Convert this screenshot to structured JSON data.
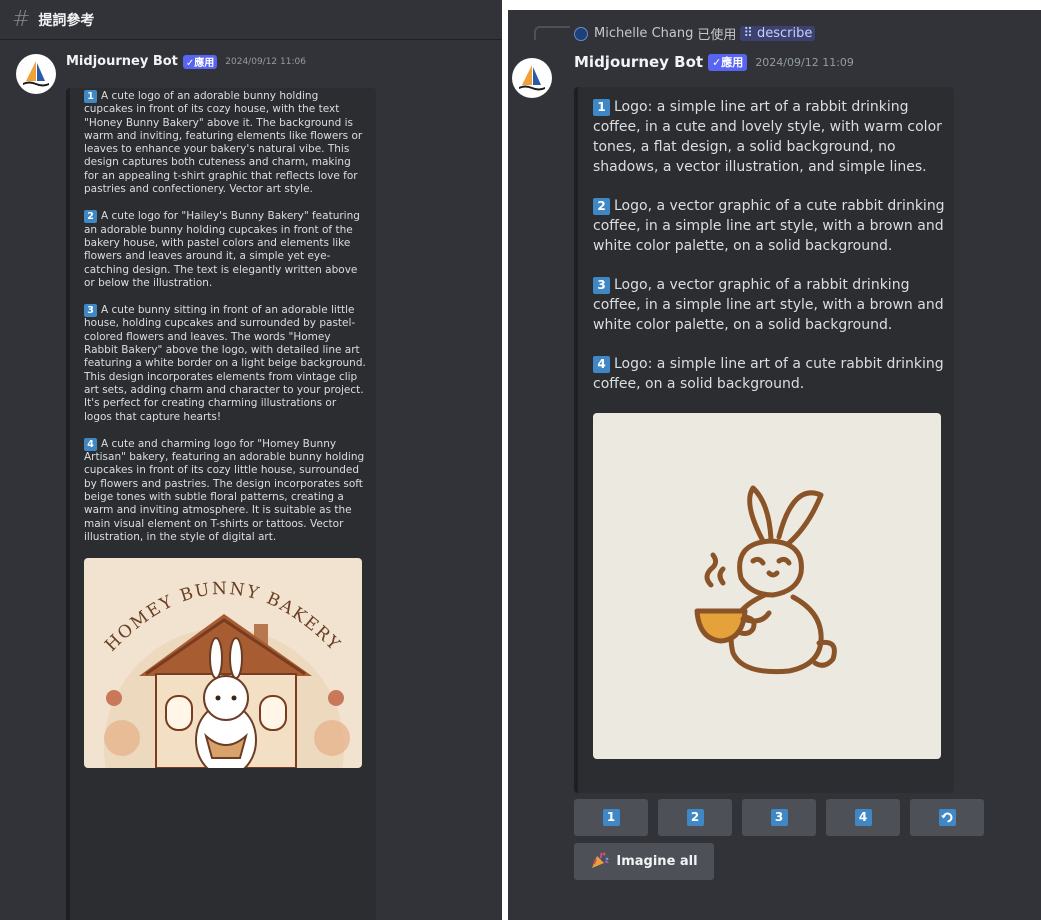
{
  "left_panel": {
    "channel": {
      "icon": "hash-icon",
      "name": "提詞參考"
    },
    "message": {
      "author": "Midjourney Bot",
      "app_badge": "✓應用",
      "timestamp": "2024/09/12 11:06",
      "prompts": [
        {
          "num": "1",
          "text": "A cute logo of an adorable bunny holding cupcakes in front of its cozy house, with the text \"Honey Bunny Bakery\" above it. The background is warm and inviting, featuring elements like flowers or leaves to enhance your bakery's natural vibe. This design captures both cuteness and charm, making for an appealing t-shirt graphic that reflects love for pastries and confectionery. Vector art style."
        },
        {
          "num": "2",
          "text": "A cute logo for \"Hailey's Bunny Bakery\" featuring an adorable bunny holding cupcakes in front of the bakery house, with pastel colors and elements like flowers and leaves around it, a simple yet eye-catching design. The text is elegantly written above or below the illustration."
        },
        {
          "num": "3",
          "text": "A cute bunny sitting in front of an adorable little house, holding cupcakes and surrounded by pastel-colored flowers and leaves. The words \"Homey Rabbit Bakery\" above the logo, with detailed line art featuring a white border on a light beige background. This design incorporates elements from vintage clip art sets, adding charm and character to your project. It's perfect for creating charming illustrations or logos that capture hearts!"
        },
        {
          "num": "4",
          "text": "A cute and charming logo for \"Homey Bunny Artisan\" bakery, featuring an adorable bunny holding cupcakes in front of its cozy little house, surrounded by flowers and pastries. The design incorporates soft beige tones with subtle floral patterns, creating a warm and inviting atmosphere. It is suitable as the main visual element on T-shirts or tattoos. Vector illustration, in the style of digital art."
        }
      ],
      "image_text": "HOMEY BUNNY BAKERY"
    }
  },
  "right_panel": {
    "reply": {
      "user": "Michelle Chang",
      "action": "已使用",
      "command": "describe"
    },
    "message": {
      "author": "Midjourney Bot",
      "app_badge": "✓應用",
      "timestamp": "2024/09/12 11:09",
      "prompts": [
        {
          "num": "1",
          "text": "Logo: a simple line art of a rabbit drinking coffee, in a cute and lovely style, with warm color tones, a flat design, a solid background, no shadows, a vector illustration, and simple lines."
        },
        {
          "num": "2",
          "text": "Logo, a vector graphic of a cute rabbit drinking coffee, in a simple line art style, with a brown and white color palette, on a solid background."
        },
        {
          "num": "3",
          "text": "Logo, a vector graphic of a rabbit drinking coffee, in a simple line art style, with a brown and white color palette, on a solid background."
        },
        {
          "num": "4",
          "text": "Logo: a simple line art of a cute rabbit drinking coffee, on a solid background."
        }
      ]
    },
    "buttons": [
      {
        "label": "1"
      },
      {
        "label": "2"
      },
      {
        "label": "3"
      },
      {
        "label": "4"
      },
      {
        "icon": "refresh-icon"
      }
    ],
    "imagine_all": {
      "icon": "party-popper-icon",
      "label": "Imagine all"
    }
  },
  "colors": {
    "background": "#313338",
    "embed": "#2b2d31",
    "number_badge": "#3f88c5",
    "app_badge": "#5865f2",
    "button": "#4e5058"
  }
}
